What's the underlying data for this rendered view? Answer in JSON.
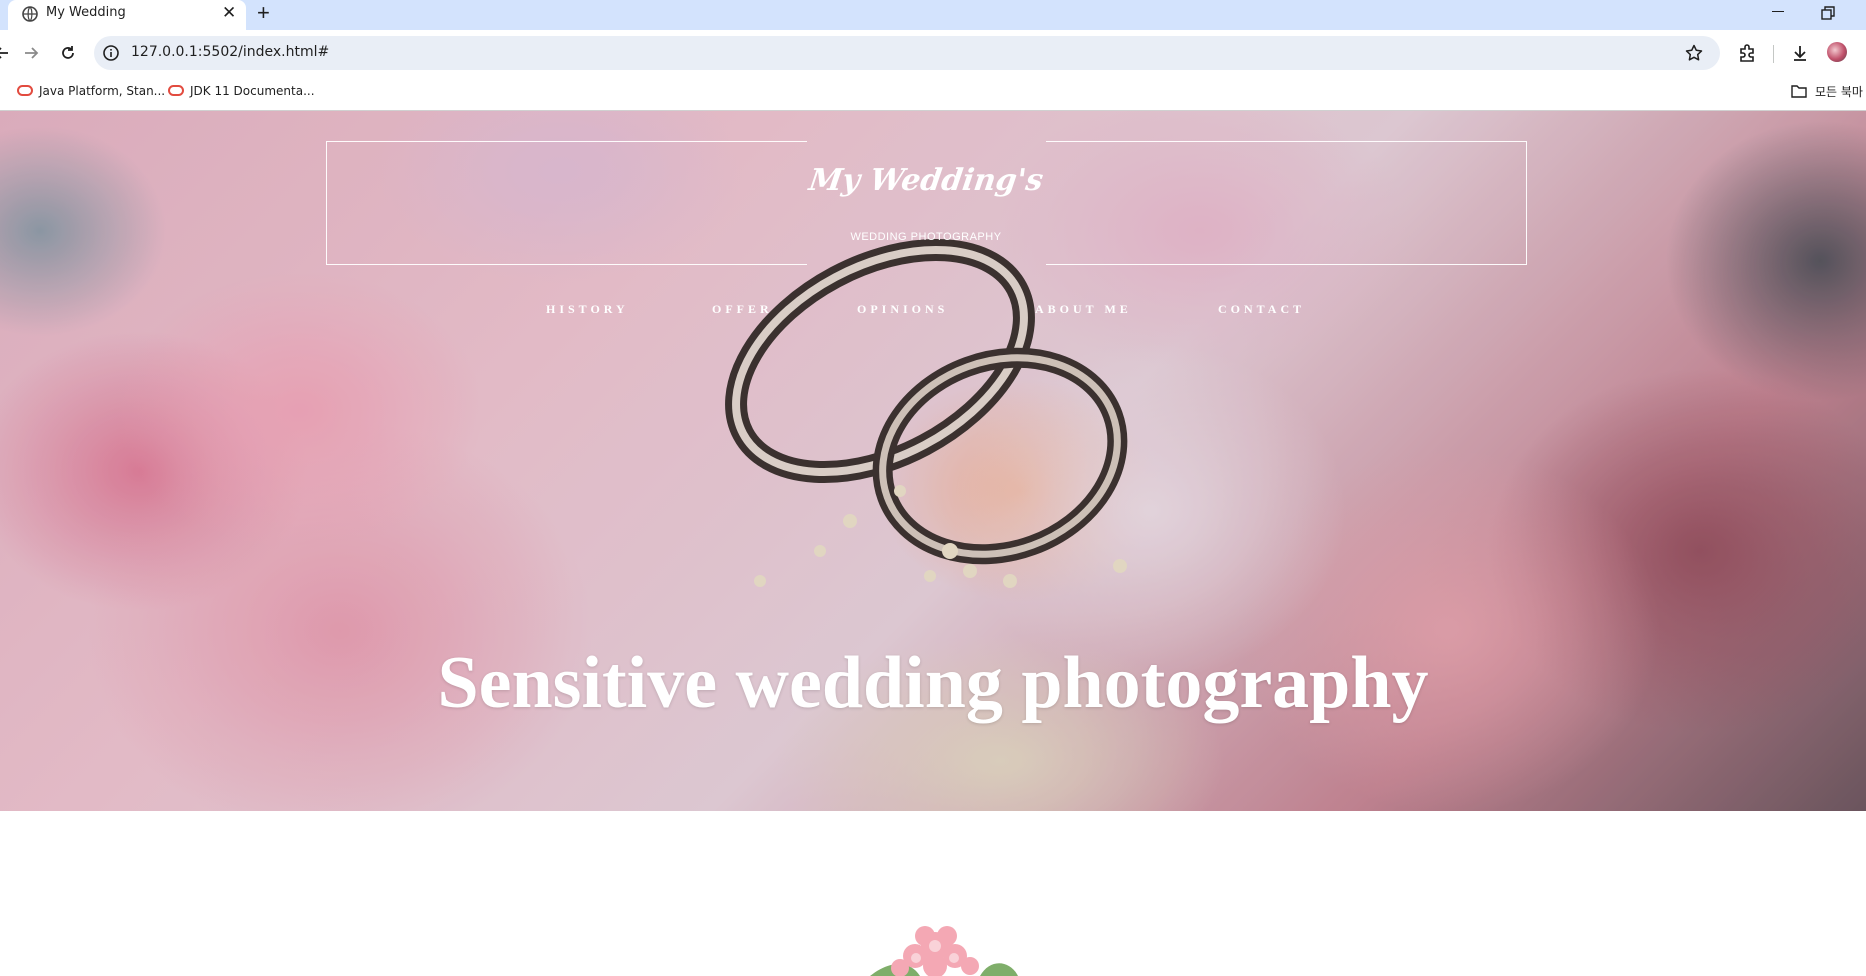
{
  "browser": {
    "tab_title": "My Wedding",
    "tab_close": "✕",
    "new_tab": "+",
    "url": "127.0.0.1:5502/index.html#",
    "bookmarks": [
      "Java Platform, Stan...",
      "JDK 11 Documenta..."
    ],
    "all_bookmarks": "모든 북마"
  },
  "site": {
    "brand_title": "My Wedding's",
    "brand_subtitle": "WEDDING PHOTOGRAPHY",
    "nav": [
      "HISTORY",
      "OFFER",
      "OPINIONS",
      "ABOUT ME",
      "CONTACT"
    ],
    "hero_heading": "Sensitive wedding photography"
  },
  "colors": {
    "tabstrip": "#d3e3fd",
    "omnibox": "#e9eef6",
    "hero_text": "#ffffff"
  }
}
